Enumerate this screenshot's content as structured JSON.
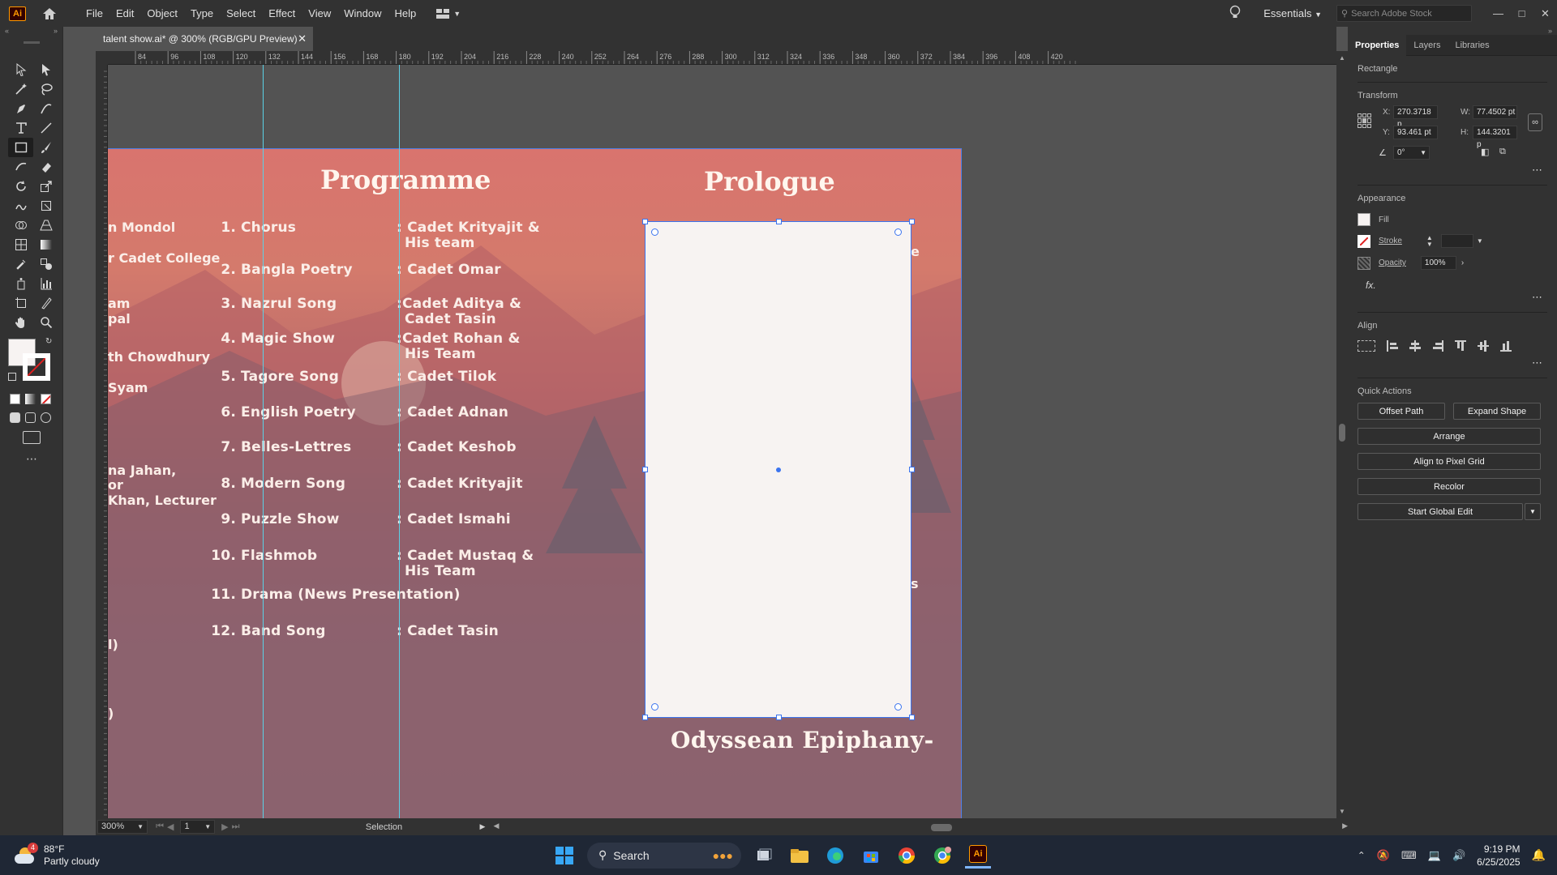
{
  "menubar": {
    "logo": "Ai",
    "items": [
      "File",
      "Edit",
      "Object",
      "Type",
      "Select",
      "Effect",
      "View",
      "Window",
      "Help"
    ],
    "workspace": "Essentials",
    "search_placeholder": "Search Adobe Stock"
  },
  "document": {
    "tab_title": "talent show.ai* @ 300% (RGB/GPU Preview)"
  },
  "ruler": {
    "top_ticks": [
      "84",
      "96",
      "108",
      "120",
      "132",
      "144",
      "156",
      "168",
      "180",
      "192",
      "204",
      "216",
      "228",
      "240",
      "252",
      "264",
      "276",
      "288",
      "300",
      "312",
      "324",
      "336",
      "348",
      "360",
      "372",
      "384",
      "396",
      "408",
      "420"
    ]
  },
  "artboard": {
    "programme_title": "Programme",
    "prologue_title": "Prologue",
    "footer_title": "Odyssean Epiphany-",
    "left_fragments": [
      "n Mondol",
      "r Cadet College",
      "am",
      "pal",
      "th Chowdhury",
      "Syam",
      "na Jahan,",
      "or",
      "Khan, Lecturer",
      "l)",
      ")"
    ],
    "right_fragments": [
      "e",
      "s"
    ],
    "programme": [
      {
        "num": "1.",
        "name": "Chorus",
        "performer": ": Cadet Krityajit &",
        "performer2": "His team"
      },
      {
        "num": "2.",
        "name": "Bangla Poetry",
        "performer": ":  Cadet Omar",
        "performer2": ""
      },
      {
        "num": "3.",
        "name": "Nazrul Song",
        "performer": ":Cadet Aditya &",
        "performer2": "Cadet Tasin"
      },
      {
        "num": "4.",
        "name": "Magic Show",
        "performer": ":Cadet Rohan &",
        "performer2": "His Team"
      },
      {
        "num": "5.",
        "name": "Tagore Song",
        "performer": ": Cadet Tilok",
        "performer2": ""
      },
      {
        "num": "6.",
        "name": "English Poetry",
        "performer": ": Cadet Adnan",
        "performer2": ""
      },
      {
        "num": "7.",
        "name": "Belles-Lettres",
        "performer": ": Cadet Keshob",
        "performer2": ""
      },
      {
        "num": "8.",
        "name": "Modern Song",
        "performer": ": Cadet Krityajit",
        "performer2": ""
      },
      {
        "num": "9.",
        "name": "Puzzle Show",
        "performer": ":  Cadet Ismahi",
        "performer2": ""
      },
      {
        "num": "10.",
        "name": "Flashmob",
        "performer": ": Cadet Mustaq &",
        "performer2": "His Team"
      },
      {
        "num": "11.",
        "name": "Drama (News Presentation)",
        "performer": "",
        "performer2": ""
      },
      {
        "num": "12.",
        "name": "Band Song",
        "performer": ": Cadet Tasin",
        "performer2": ""
      }
    ]
  },
  "status": {
    "zoom": "300%",
    "page": "1",
    "tool": "Selection"
  },
  "properties": {
    "tabs": [
      "Properties",
      "Layers",
      "Libraries"
    ],
    "object_type": "Rectangle",
    "transform_label": "Transform",
    "x_label": "X:",
    "x": "270.3718 p",
    "y_label": "Y:",
    "y": "93.461 pt",
    "w_label": "W:",
    "w": "77.4502 pt",
    "h_label": "H:",
    "h": "144.3201 p",
    "angle": "0°",
    "appearance_label": "Appearance",
    "fill_label": "Fill",
    "stroke_label": "Stroke",
    "opacity_label": "Opacity",
    "opacity": "100%",
    "fx": "fx.",
    "align_label": "Align",
    "quick_actions_label": "Quick Actions",
    "offset_path": "Offset Path",
    "expand_shape": "Expand Shape",
    "arrange": "Arrange",
    "align_pixel": "Align to Pixel Grid",
    "recolor": "Recolor",
    "global_edit": "Start Global Edit"
  },
  "taskbar": {
    "temp": "88°F",
    "weather": "Partly cloudy",
    "weather_badge": "4",
    "search": "Search",
    "time": "9:19 PM",
    "date": "6/25/2025"
  },
  "colors": {
    "accent": "#3b74ef",
    "guide": "#5ad1e6",
    "ai_orange": "#ff9a00"
  }
}
